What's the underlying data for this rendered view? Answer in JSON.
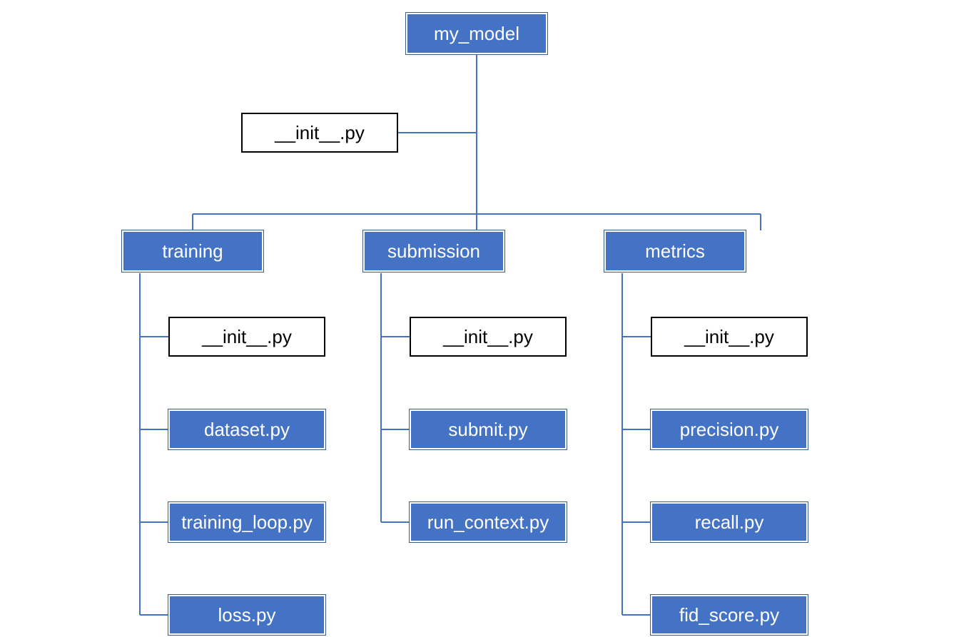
{
  "root": {
    "label": "my_model",
    "init": "__init__.py",
    "children": [
      {
        "label": "training",
        "files": [
          {
            "label": "__init__.py",
            "style": "plain"
          },
          {
            "label": "dataset.py",
            "style": "blue"
          },
          {
            "label": "training_loop.py",
            "style": "blue"
          },
          {
            "label": "loss.py",
            "style": "blue"
          }
        ]
      },
      {
        "label": "submission",
        "files": [
          {
            "label": "__init__.py",
            "style": "plain"
          },
          {
            "label": "submit.py",
            "style": "blue"
          },
          {
            "label": "run_context.py",
            "style": "blue"
          }
        ]
      },
      {
        "label": "metrics",
        "files": [
          {
            "label": "__init__.py",
            "style": "plain"
          },
          {
            "label": "precision.py",
            "style": "blue"
          },
          {
            "label": "recall.py",
            "style": "blue"
          },
          {
            "label": "fid_score.py",
            "style": "blue"
          }
        ]
      }
    ]
  },
  "colors": {
    "folder": "#4472C4",
    "connector": "#4472C4"
  }
}
